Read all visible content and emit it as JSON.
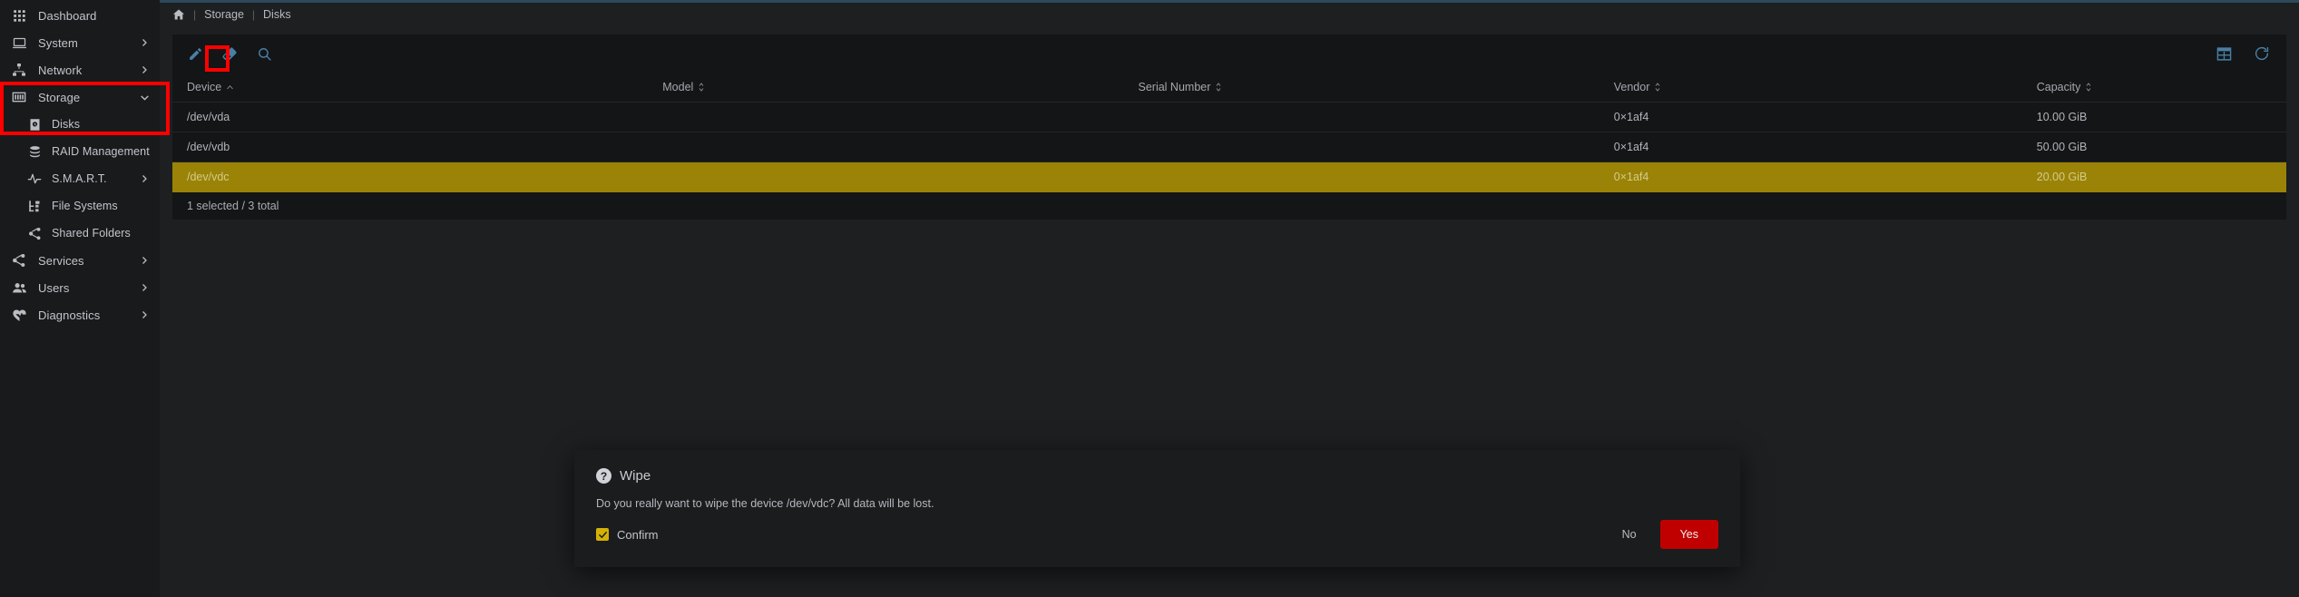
{
  "sidebar": {
    "items": [
      {
        "label": "Dashboard",
        "icon": "grid-apps-icon",
        "level": 0,
        "chevron": "none",
        "active": false
      },
      {
        "label": "System",
        "icon": "laptop-icon",
        "level": 0,
        "chevron": "right",
        "active": false
      },
      {
        "label": "Network",
        "icon": "network-icon",
        "level": 0,
        "chevron": "right",
        "active": false
      },
      {
        "label": "Storage",
        "icon": "storage-icon",
        "level": 0,
        "chevron": "down",
        "active": true
      },
      {
        "label": "Disks",
        "icon": "hard-disk-icon",
        "level": 1,
        "chevron": "none",
        "active": true
      },
      {
        "label": "RAID Management",
        "icon": "database-stack-icon",
        "level": 1,
        "chevron": "none",
        "active": false
      },
      {
        "label": "S.M.A.R.T.",
        "icon": "pulse-icon",
        "level": 1,
        "chevron": "right",
        "active": false
      },
      {
        "label": "File Systems",
        "icon": "file-tree-icon",
        "level": 1,
        "chevron": "none",
        "active": false
      },
      {
        "label": "Shared Folders",
        "icon": "share-nodes-icon",
        "level": 1,
        "chevron": "none",
        "active": false
      },
      {
        "label": "Services",
        "icon": "share-nodes-icon",
        "level": 0,
        "chevron": "right",
        "active": false
      },
      {
        "label": "Users",
        "icon": "users-icon",
        "level": 0,
        "chevron": "right",
        "active": false
      },
      {
        "label": "Diagnostics",
        "icon": "heartbeat-icon",
        "level": 0,
        "chevron": "right",
        "active": false
      }
    ]
  },
  "breadcrumb": {
    "home_icon": "home-icon",
    "separator": "|",
    "items": [
      "Storage",
      "Disks"
    ]
  },
  "toolbar": {
    "left": [
      {
        "name": "edit-button",
        "icon": "pencil-icon"
      },
      {
        "name": "wipe-button",
        "icon": "eraser-icon",
        "highlighted": true
      },
      {
        "name": "search-button",
        "icon": "magnifier-icon"
      }
    ],
    "right": [
      {
        "name": "column-chooser-button",
        "icon": "table-grid-icon"
      },
      {
        "name": "reload-button",
        "icon": "refresh-icon"
      }
    ]
  },
  "table": {
    "columns": [
      {
        "label": "Device",
        "sort": "asc"
      },
      {
        "label": "Model",
        "sort": "none"
      },
      {
        "label": "Serial Number",
        "sort": "none"
      },
      {
        "label": "Vendor",
        "sort": "none"
      },
      {
        "label": "Capacity",
        "sort": "none"
      }
    ],
    "rows": [
      {
        "device": "/dev/vda",
        "model": "",
        "serial": "",
        "vendor": "0×1af4",
        "capacity": "10.00 GiB",
        "selected": false
      },
      {
        "device": "/dev/vdb",
        "model": "",
        "serial": "",
        "vendor": "0×1af4",
        "capacity": "50.00 GiB",
        "selected": false
      },
      {
        "device": "/dev/vdc",
        "model": "",
        "serial": "",
        "vendor": "0×1af4",
        "capacity": "20.00 GiB",
        "selected": true
      }
    ],
    "footer": "1 selected / 3 total"
  },
  "dialog": {
    "icon": "question-circle-icon",
    "title": "Wipe",
    "message": "Do you really want to wipe the device /dev/vdc? All data will be lost.",
    "confirm_label": "Confirm",
    "confirm_checked": true,
    "no_label": "No",
    "yes_label": "Yes"
  },
  "colors": {
    "accent_blue": "#4a7fa5",
    "selected_row": "#9a8307",
    "danger_red": "#c00000",
    "checkbox_gold": "#d4b106",
    "highlight_annotation": "#ff0000",
    "sidebar_bg": "#181a1c",
    "panel_bg": "#131517",
    "page_bg": "#1d1f21"
  }
}
